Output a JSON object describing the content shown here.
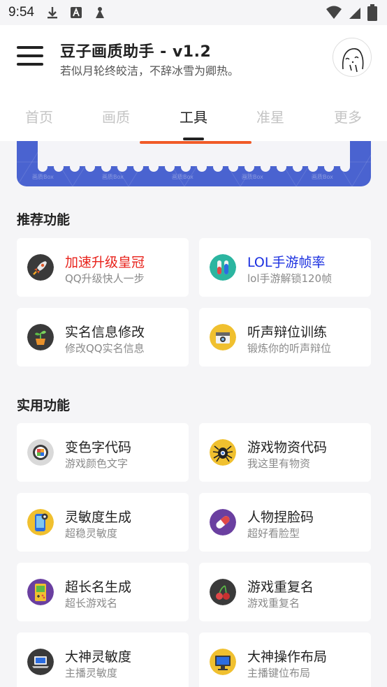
{
  "status_bar": {
    "time": "9:54"
  },
  "header": {
    "title": "豆子画质助手 - v1.2",
    "subtitle": "若似月轮终皎洁，不辞冰雪为卿热。"
  },
  "tabs": [
    {
      "label": "首页",
      "active": false
    },
    {
      "label": "画质",
      "active": false
    },
    {
      "label": "工具",
      "active": true
    },
    {
      "label": "准星",
      "active": false
    },
    {
      "label": "更多",
      "active": false
    }
  ],
  "banner": {
    "watermark": "画质Box"
  },
  "sections": {
    "recommended": {
      "title": "推荐功能",
      "items": [
        {
          "title": "加速升级皇冠",
          "subtitle": "QQ升级快人一步",
          "title_color": "#e8221b",
          "icon": "rocket-icon"
        },
        {
          "title": "LOL手游帧率",
          "subtitle": "lol手游解锁120帧",
          "title_color": "#1a2fe0",
          "icon": "test-tubes-icon"
        },
        {
          "title": "实名信息修改",
          "subtitle": "修改QQ实名信息",
          "title_color": "#222222",
          "icon": "plant-pot-icon"
        },
        {
          "title": "听声辩位训练",
          "subtitle": "锻炼你的听声辩位",
          "title_color": "#222222",
          "icon": "camera-icon"
        }
      ]
    },
    "utility": {
      "title": "实用功能",
      "items": [
        {
          "title": "变色字代码",
          "subtitle": "游戏颜色文字",
          "title_color": "#222222",
          "icon": "sushi-icon"
        },
        {
          "title": "游戏物资代码",
          "subtitle": "我这里有物资",
          "title_color": "#222222",
          "icon": "spider-icon"
        },
        {
          "title": "灵敏度生成",
          "subtitle": "超稳灵敏度",
          "title_color": "#222222",
          "icon": "phone-icon"
        },
        {
          "title": "人物捏脸码",
          "subtitle": "超好看脸型",
          "title_color": "#222222",
          "icon": "pill-icon"
        },
        {
          "title": "超长名生成",
          "subtitle": "超长游戏名",
          "title_color": "#222222",
          "icon": "gameboy-icon"
        },
        {
          "title": "游戏重复名",
          "subtitle": "游戏重复名",
          "title_color": "#222222",
          "icon": "cherry-icon"
        },
        {
          "title": "大神灵敏度",
          "subtitle": "主播灵敏度",
          "title_color": "#222222",
          "icon": "laptop-icon"
        },
        {
          "title": "大神操作布局",
          "subtitle": "主播键位布局",
          "title_color": "#222222",
          "icon": "monitor-icon"
        }
      ]
    }
  }
}
